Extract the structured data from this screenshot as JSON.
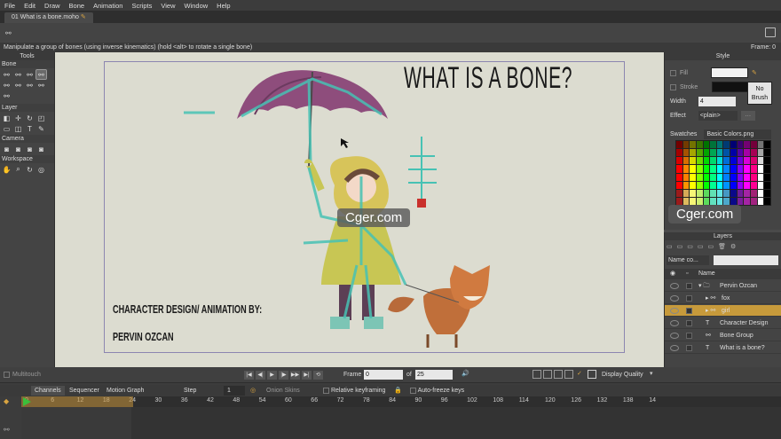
{
  "menu": [
    "File",
    "Edit",
    "Draw",
    "Bone",
    "Animation",
    "Scripts",
    "View",
    "Window",
    "Help"
  ],
  "document_tab": "01 What is a bone.moho",
  "status_message": "Manipulate a group of bones (using inverse kinematics) (hold <alt> to rotate a single bone)",
  "frame_status": "Frame: 0",
  "tools": {
    "title": "Tools",
    "sections": [
      "Bone",
      "Layer",
      "Camera",
      "Workspace"
    ]
  },
  "canvas": {
    "title": "WHAT IS A BONE?",
    "credit_line1": "CHARACTER DESIGN/ ANIMATION BY:",
    "credit_line2": "PERVIN OZCAN"
  },
  "watermark": "Cger.com",
  "style_panel": {
    "title": "Style",
    "fill_label": "Fill",
    "stroke_label": "Stroke",
    "width_label": "Width",
    "width_value": "4",
    "effect_label": "Effect",
    "effect_value": "<plain>",
    "no_brush_line1": "No",
    "no_brush_line2": "Brush",
    "swatches_label": "Swatches",
    "swatches_value": "Basic Colors.png",
    "fill_color": "#f2f2f2",
    "stroke_color": "#111111"
  },
  "layers_panel": {
    "title": "Layers",
    "filter_placeholder": "Name co...",
    "name_header": "Name",
    "rows": [
      {
        "name": "Pervin Ozcan",
        "type": "folder"
      },
      {
        "name": "fox",
        "type": "bone"
      },
      {
        "name": "girl",
        "type": "bone"
      },
      {
        "name": "Character Design",
        "type": "text"
      },
      {
        "name": "Bone Group",
        "type": "group"
      },
      {
        "name": "What is a bone?",
        "type": "text"
      }
    ],
    "selected_index": 2
  },
  "playback": {
    "multitouch": "Multitouch",
    "frame_label": "Frame",
    "frame_value": "0",
    "of_label": "of",
    "total_frames": "25",
    "display_quality": "Display Quality"
  },
  "timeline": {
    "tabs": [
      "Channels",
      "Sequencer",
      "Motion Graph"
    ],
    "step_label": "Step",
    "step_value": "1",
    "onion_skins": "Onion Skins",
    "relative_keyframing": "Relative keyframing",
    "auto_freeze": "Auto-freeze keys",
    "ruler": [
      "0",
      "6",
      "12",
      "18",
      "24",
      "30",
      "36",
      "42",
      "48",
      "54",
      "60",
      "66",
      "72",
      "78",
      "84",
      "90",
      "96",
      "102",
      "108",
      "114",
      "120",
      "126",
      "132",
      "138",
      "14"
    ]
  }
}
